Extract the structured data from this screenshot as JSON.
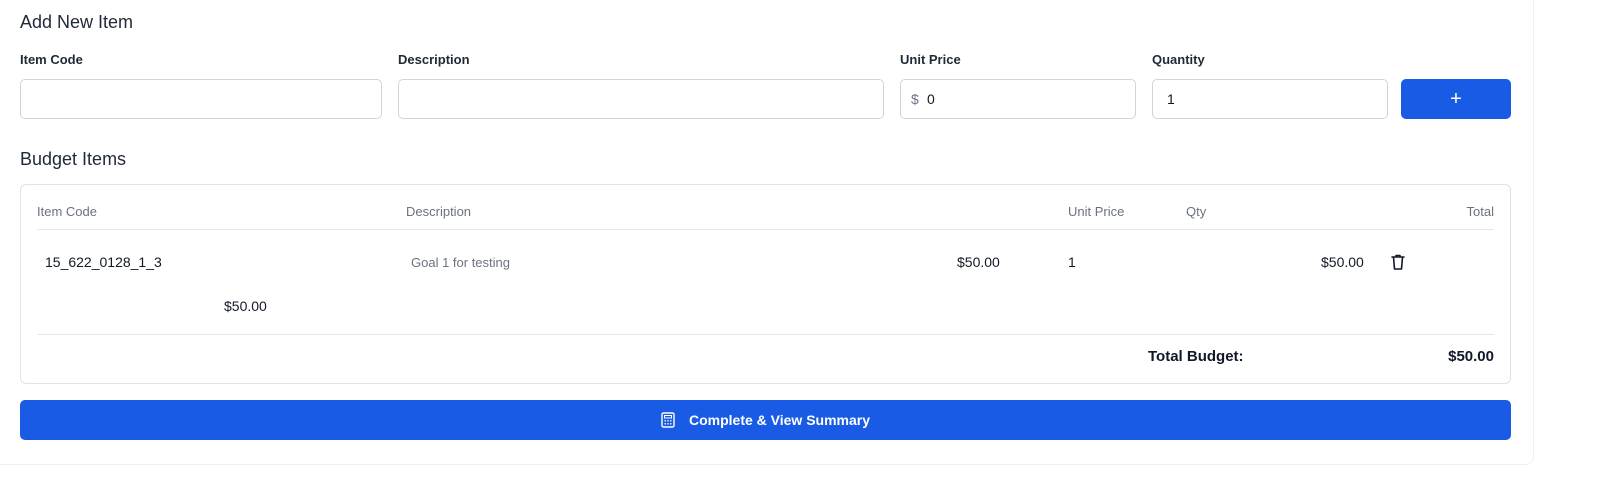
{
  "add_section": {
    "title": "Add New Item",
    "labels": {
      "item_code": "Item Code",
      "description": "Description",
      "unit_price": "Unit Price",
      "quantity": "Quantity"
    },
    "inputs": {
      "item_code": "",
      "description": "",
      "currency_symbol": "$",
      "unit_price": "0",
      "quantity": "1"
    },
    "add_button_label": "+"
  },
  "budget_section": {
    "title": "Budget Items",
    "headers": {
      "item_code": "Item Code",
      "description": "Description",
      "unit_price": "Unit Price",
      "qty": "Qty",
      "total": "Total"
    },
    "rows": [
      {
        "item_code": "15_622_0128_1_3",
        "description": "Goal 1 for testing",
        "unit_price": "$50.00",
        "qty": "1",
        "total": "$50.00",
        "subtotal": "$50.00"
      }
    ],
    "total_budget_label": "Total Budget:",
    "total_budget_value": "$50.00"
  },
  "summary_button_label": "Complete & View Summary",
  "colors": {
    "primary": "#1a5be6",
    "border": "#d1d5db",
    "muted_text": "#6b7280"
  },
  "icons": {
    "delete": "trash-icon",
    "summary": "calculator-icon"
  }
}
